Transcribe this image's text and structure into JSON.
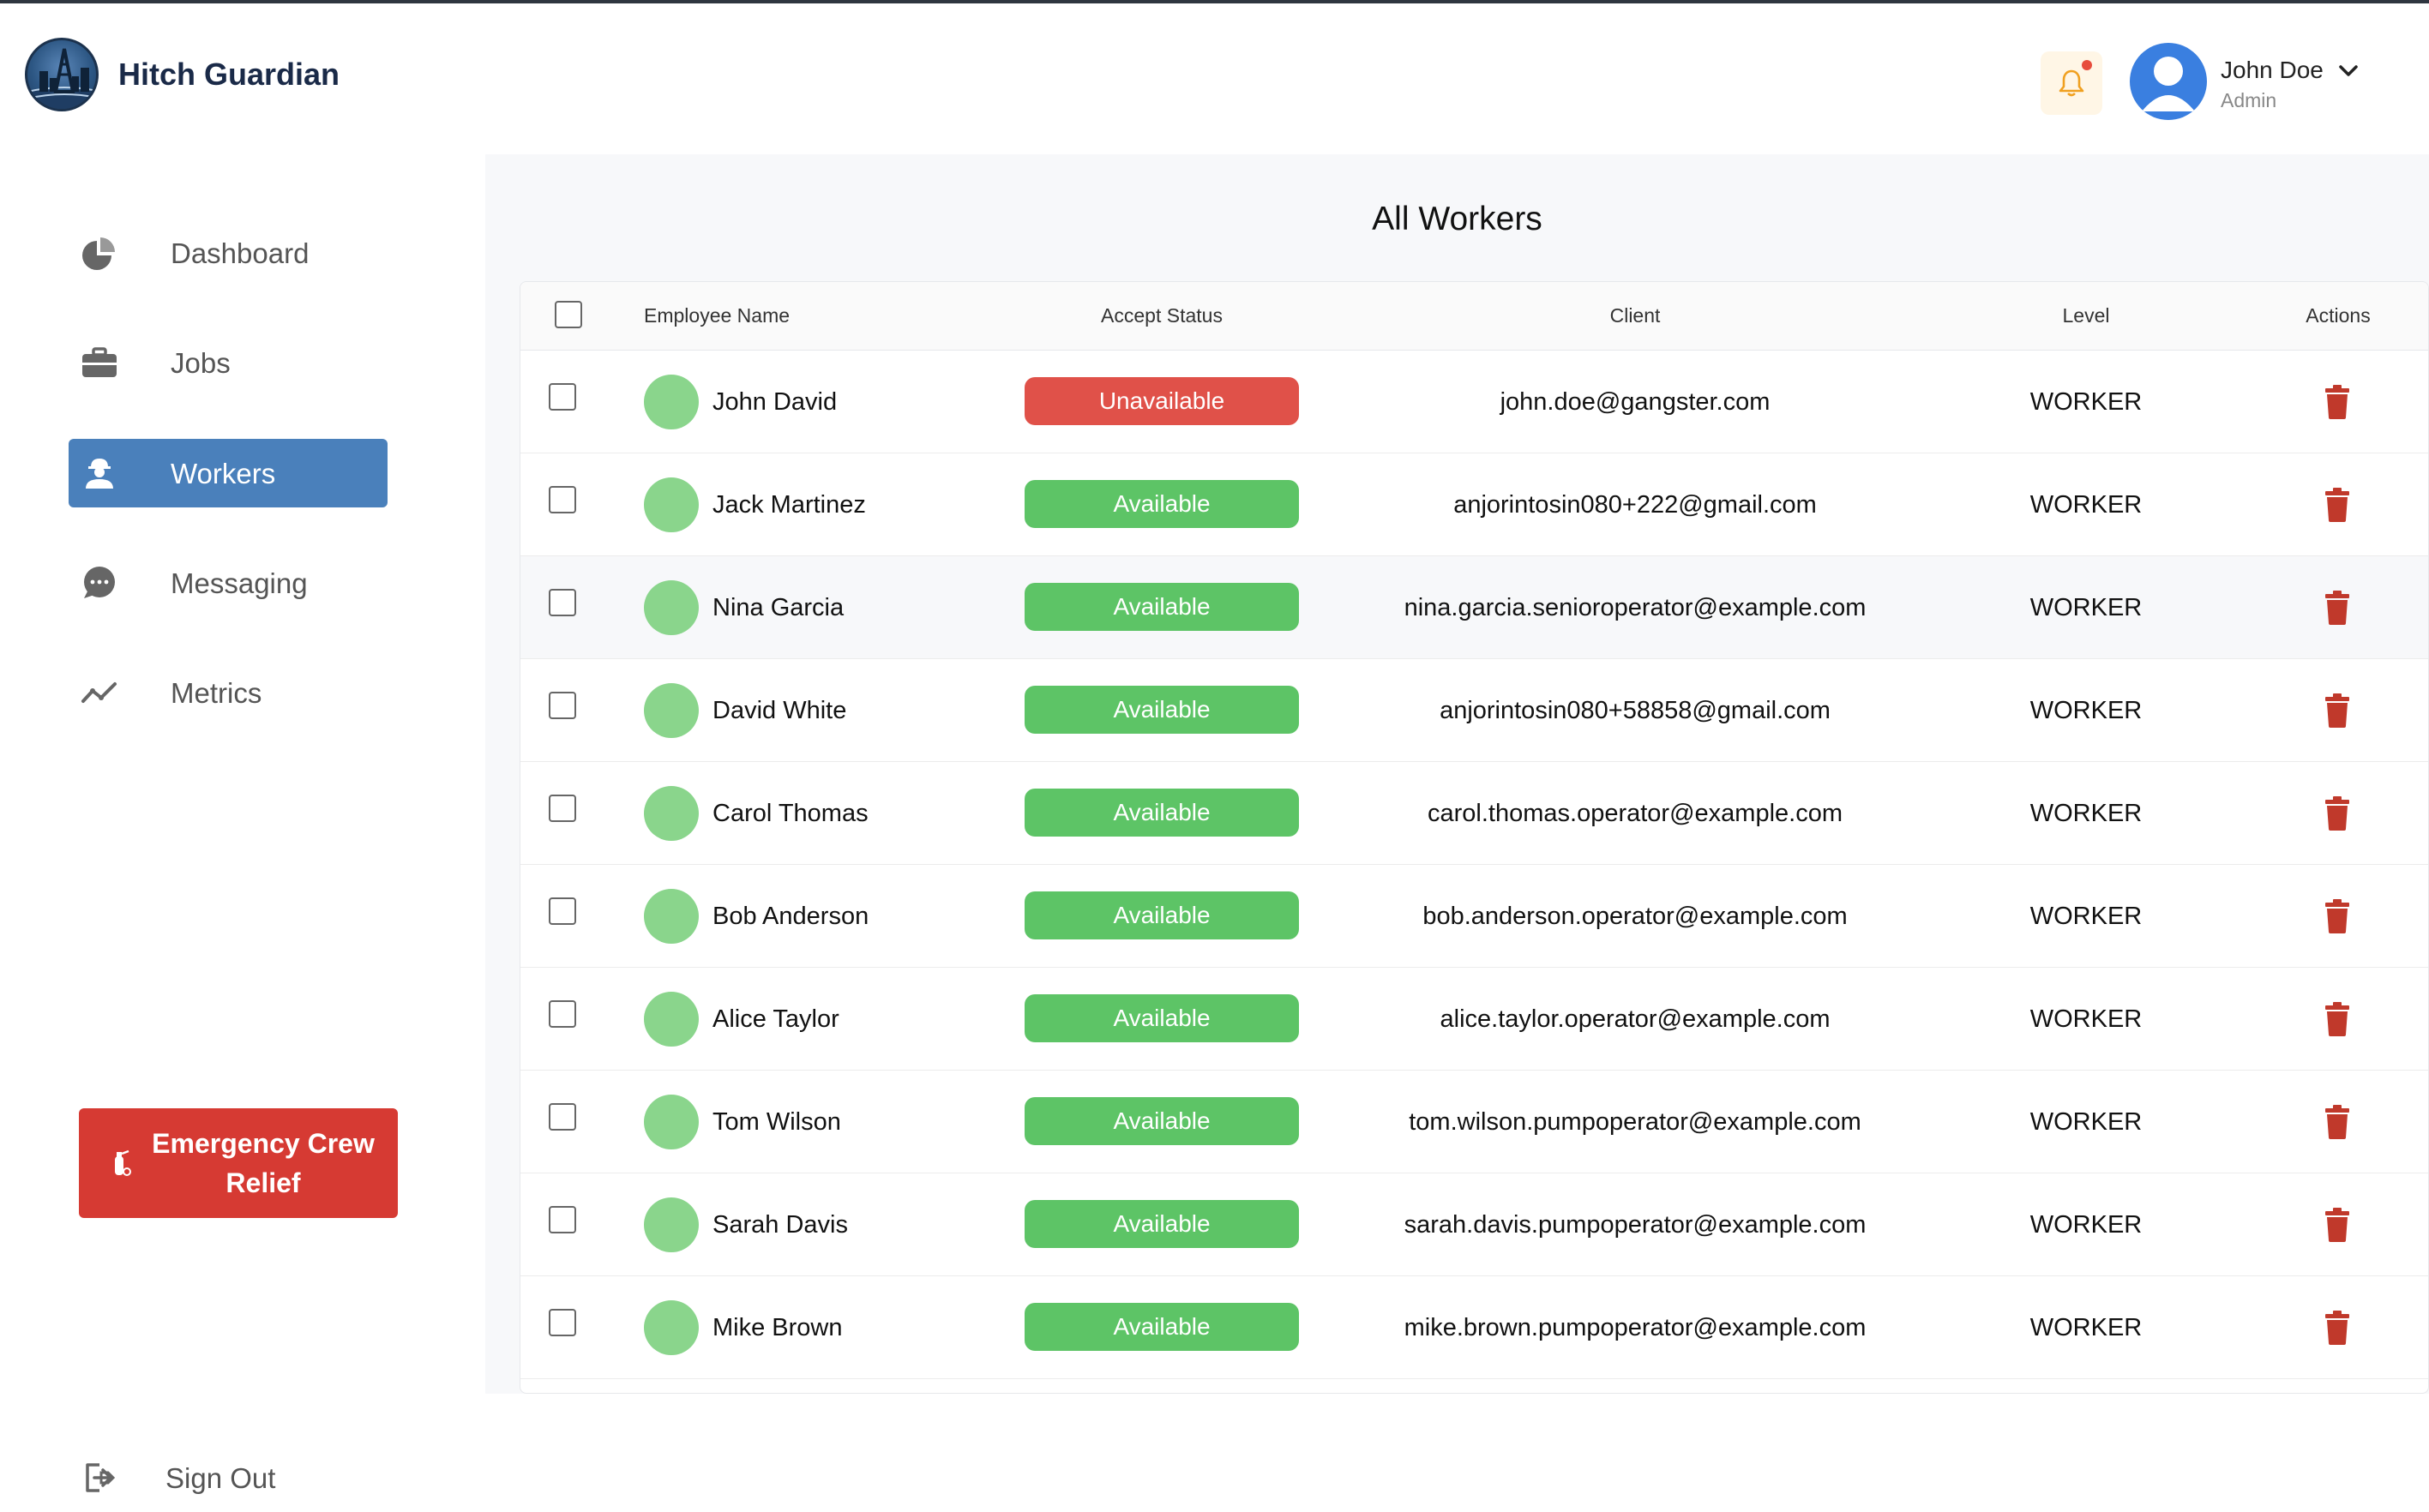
{
  "app": {
    "brand": "Hitch Guardian"
  },
  "header": {
    "user_name": "John Doe",
    "user_role": "Admin"
  },
  "sidebar": {
    "items": [
      {
        "label": "Dashboard",
        "icon": "pie-chart-icon"
      },
      {
        "label": "Jobs",
        "icon": "briefcase-icon"
      },
      {
        "label": "Workers",
        "icon": "worker-icon",
        "active": true
      },
      {
        "label": "Messaging",
        "icon": "chat-bubble-icon"
      },
      {
        "label": "Metrics",
        "icon": "line-chart-icon"
      }
    ],
    "emergency_label": "Emergency Crew Relief",
    "signout_label": "Sign Out"
  },
  "main": {
    "title": "All Workers",
    "columns": [
      "Employee Name",
      "Accept Status",
      "Client",
      "Level",
      "Actions"
    ],
    "rows": [
      {
        "name": "John David",
        "status": "Unavailable",
        "client": "john.doe@gangster.com",
        "level": "WORKER"
      },
      {
        "name": "Jack Martinez",
        "status": "Available",
        "client": "anjorintosin080+222@gmail.com",
        "level": "WORKER"
      },
      {
        "name": "Nina Garcia",
        "status": "Available",
        "client": "nina.garcia.senioroperator@example.com",
        "level": "WORKER"
      },
      {
        "name": "David White",
        "status": "Available",
        "client": "anjorintosin080+58858@gmail.com",
        "level": "WORKER"
      },
      {
        "name": "Carol Thomas",
        "status": "Available",
        "client": "carol.thomas.operator@example.com",
        "level": "WORKER"
      },
      {
        "name": "Bob Anderson",
        "status": "Available",
        "client": "bob.anderson.operator@example.com",
        "level": "WORKER"
      },
      {
        "name": "Alice Taylor",
        "status": "Available",
        "client": "alice.taylor.operator@example.com",
        "level": "WORKER"
      },
      {
        "name": "Tom Wilson",
        "status": "Available",
        "client": "tom.wilson.pumpoperator@example.com",
        "level": "WORKER"
      },
      {
        "name": "Sarah Davis",
        "status": "Available",
        "client": "sarah.davis.pumpoperator@example.com",
        "level": "WORKER"
      },
      {
        "name": "Mike Brown",
        "status": "Available",
        "client": "mike.brown.pumpoperator@example.com",
        "level": "WORKER"
      }
    ]
  },
  "colors": {
    "accent": "#4a80bb",
    "available": "#5dc466",
    "unavailable": "#e05149",
    "emergency": "#d63a33",
    "trash": "#c0392b"
  }
}
